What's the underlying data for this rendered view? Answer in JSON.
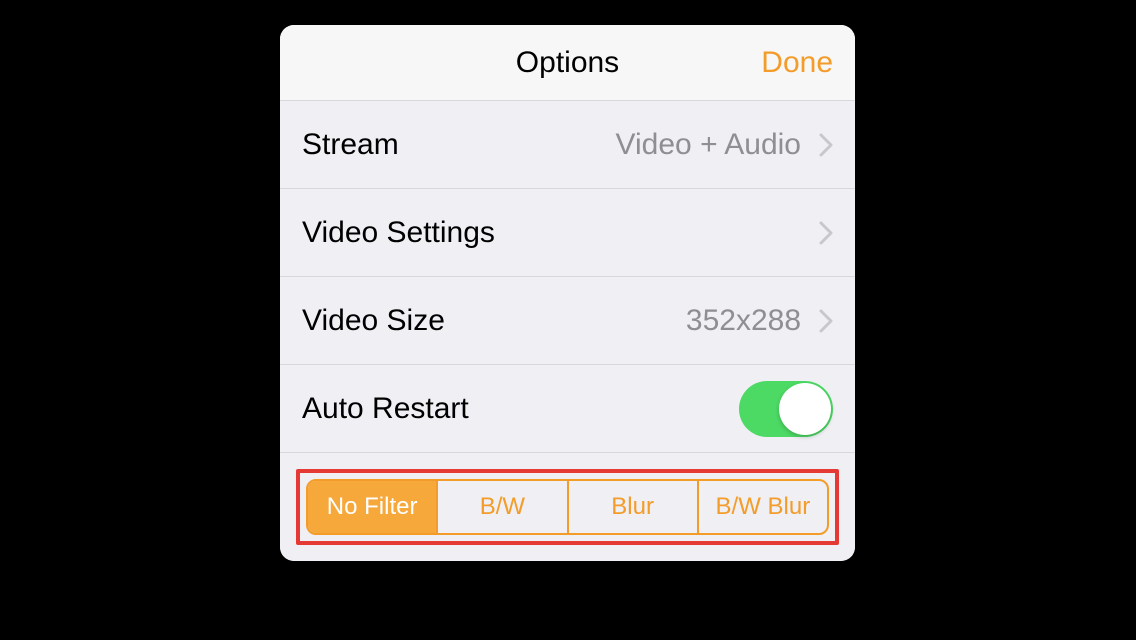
{
  "header": {
    "title": "Options",
    "done": "Done"
  },
  "rows": {
    "stream": {
      "label": "Stream",
      "value": "Video + Audio"
    },
    "videoSettings": {
      "label": "Video Settings"
    },
    "videoSize": {
      "label": "Video Size",
      "value": "352x288"
    },
    "autoRestart": {
      "label": "Auto Restart",
      "on": true
    }
  },
  "filters": {
    "options": [
      "No Filter",
      "B/W",
      "Blur",
      "B/W Blur"
    ],
    "selected": 0
  }
}
